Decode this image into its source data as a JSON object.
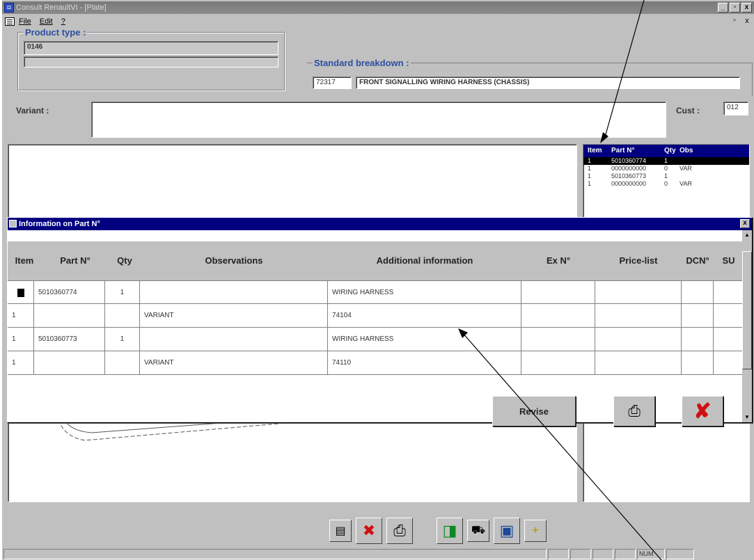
{
  "window": {
    "title": "Consult RenaultVI - [Plate]",
    "app_icon": "app-icon",
    "controls": [
      "_",
      "▫",
      "x"
    ]
  },
  "menu": {
    "items": [
      "File",
      "Edit",
      "?"
    ],
    "restore_glyph": "▫",
    "close_glyph": "x"
  },
  "product": {
    "group_label": "Product type :",
    "code": "0146",
    "extra": ""
  },
  "breakdown": {
    "group_label": "Standard breakdown :",
    "code": "72317",
    "description": "FRONT SIGNALLING WIRING HARNESS (CHASSIS)"
  },
  "variant": {
    "label": "Variant :",
    "value": ""
  },
  "cust": {
    "label": "Cust :",
    "value": "012"
  },
  "parts_list": {
    "columns": [
      "Item",
      "Part N°",
      "Qty",
      "Obs"
    ],
    "rows": [
      {
        "item": "1",
        "part": "5010360774",
        "qty": "1",
        "obs": ""
      },
      {
        "item": "1",
        "part": "0000000000",
        "qty": "0",
        "obs": "VAR"
      },
      {
        "item": "1",
        "part": "5010360773",
        "qty": "1",
        "obs": ""
      },
      {
        "item": "1",
        "part": "0000000000",
        "qty": "0",
        "obs": "VAR"
      }
    ]
  },
  "dialog": {
    "title": "Information on Part N°",
    "columns": {
      "item": "Item",
      "part": "Part N°",
      "qty": "Qty",
      "observations": "Observations",
      "additional": "Additional information",
      "ex": "Ex N°",
      "price": "Price-list",
      "dcn": "DCN°",
      "su": "SU"
    },
    "rows": [
      {
        "item": "",
        "part": "5010360774",
        "qty": "1",
        "obs": "",
        "info": "WIRING HARNESS",
        "ex": "",
        "price": "",
        "dcn": "",
        "su": ""
      },
      {
        "item": "1",
        "part": "",
        "qty": "",
        "obs": "VARIANT",
        "info": "74104",
        "ex": "",
        "price": "",
        "dcn": "",
        "su": ""
      },
      {
        "item": "1",
        "part": "5010360773",
        "qty": "1",
        "obs": "",
        "info": "WIRING HARNESS",
        "ex": "",
        "price": "",
        "dcn": "",
        "su": ""
      },
      {
        "item": "1",
        "part": "",
        "qty": "",
        "obs": "VARIANT",
        "info": "74110",
        "ex": "",
        "price": "",
        "dcn": "",
        "su": ""
      }
    ],
    "revise_label": "Revise",
    "print_icon": "printer-icon",
    "cancel_icon": "red-x-icon",
    "close_glyph": "x"
  },
  "toolbar": {
    "icons": [
      "list-icon",
      "delete-icon",
      "printer-icon",
      "exit-door-icon",
      "cart-icon",
      "computer-icon",
      "plus-icon"
    ]
  },
  "statusbar": {
    "num_label": "NUM"
  },
  "colors": {
    "title_active": "#000080",
    "title_inactive": "#808080",
    "face": "#c0c0c0",
    "label_blue": "#2b4fa0",
    "cancel_red": "#d01010"
  }
}
